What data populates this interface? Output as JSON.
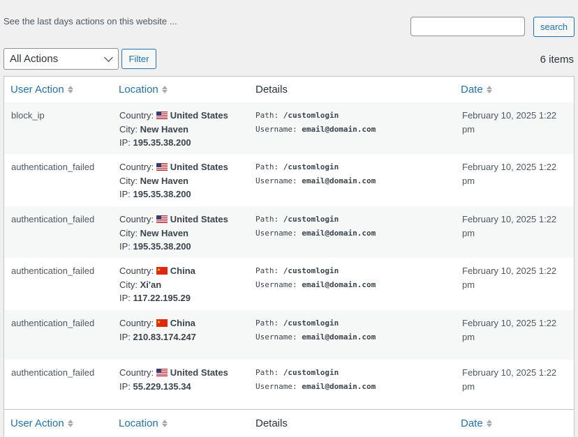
{
  "intro_text": "See the last days actions on this website ...",
  "search": {
    "value": "",
    "button_label": "search"
  },
  "filter": {
    "selected": "All Actions",
    "button_label": "Filter"
  },
  "items_count": "6 items",
  "columns": {
    "action": "User Action",
    "location": "Location",
    "details": "Details",
    "date": "Date"
  },
  "labels": {
    "country": "Country:",
    "city": "City:",
    "ip": "IP:",
    "path": "Path:",
    "username": "Username:"
  },
  "rows": [
    {
      "action": "block_ip",
      "flag": "us",
      "country": "United States",
      "city": "New Haven",
      "ip": "195.35.38.200",
      "path": "/customlogin",
      "username": "email@domain.com",
      "date": "February 10, 2025 1:22 pm"
    },
    {
      "action": "authentication_failed",
      "flag": "us",
      "country": "United States",
      "city": "New Haven",
      "ip": "195.35.38.200",
      "path": "/customlogin",
      "username": "email@domain.com",
      "date": "February 10, 2025 1:22 pm"
    },
    {
      "action": "authentication_failed",
      "flag": "us",
      "country": "United States",
      "city": "New Haven",
      "ip": "195.35.38.200",
      "path": "/customlogin",
      "username": "email@domain.com",
      "date": "February 10, 2025 1:22 pm"
    },
    {
      "action": "authentication_failed",
      "flag": "cn",
      "country": "China",
      "city": "Xi'an",
      "ip": "117.22.195.29",
      "path": "/customlogin",
      "username": "email@domain.com",
      "date": "February 10, 2025 1:22 pm"
    },
    {
      "action": "authentication_failed",
      "flag": "cn",
      "country": "China",
      "city": null,
      "ip": "210.83.174.247",
      "path": "/customlogin",
      "username": "email@domain.com",
      "date": "February 10, 2025 1:22 pm"
    },
    {
      "action": "authentication_failed",
      "flag": "us",
      "country": "United States",
      "city": null,
      "ip": "55.229.135.34",
      "path": "/customlogin",
      "username": "email@domain.com",
      "date": "February 10, 2025 1:22 pm"
    }
  ]
}
